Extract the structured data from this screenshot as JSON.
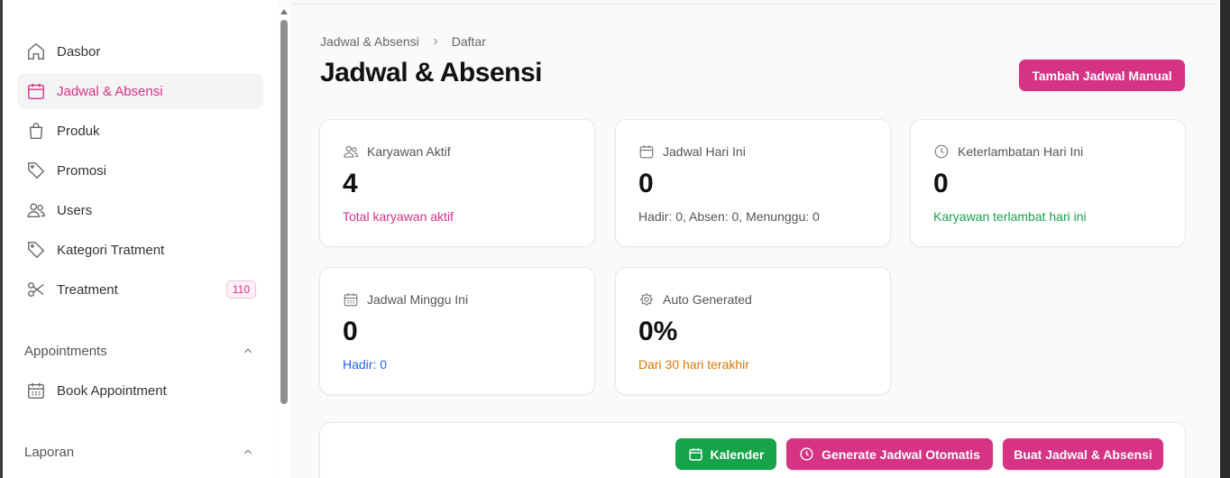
{
  "sidebar": {
    "items": [
      {
        "label": "Dasbor",
        "icon": "home-icon"
      },
      {
        "label": "Jadwal & Absensi",
        "icon": "calendar-icon",
        "active": true
      },
      {
        "label": "Produk",
        "icon": "shopping-bag-icon"
      },
      {
        "label": "Promosi",
        "icon": "tag-icon"
      },
      {
        "label": "Users",
        "icon": "users-icon"
      },
      {
        "label": "Kategori Tratment",
        "icon": "tag-icon"
      },
      {
        "label": "Treatment",
        "icon": "scissors-icon",
        "badge": "110"
      }
    ],
    "sections": [
      {
        "label": "Appointments",
        "items": [
          {
            "label": "Book Appointment",
            "icon": "calendar-days-icon"
          }
        ]
      },
      {
        "label": "Laporan"
      }
    ]
  },
  "breadcrumb": {
    "parent": "Jadwal & Absensi",
    "current": "Daftar"
  },
  "page": {
    "title": "Jadwal & Absensi",
    "add_button": "Tambah Jadwal Manual"
  },
  "stats": [
    {
      "label": "Karyawan Aktif",
      "value": "4",
      "sub": "Total karyawan aktif",
      "icon": "users-icon",
      "sub_color": "#d63384"
    },
    {
      "label": "Jadwal Hari Ini",
      "value": "0",
      "sub": "Hadir: 0, Absen: 0, Menunggu: 0",
      "icon": "calendar-icon",
      "sub_color": "#555555"
    },
    {
      "label": "Keterlambatan Hari Ini",
      "value": "0",
      "sub": "Karyawan terlambat hari ini",
      "icon": "clock-icon",
      "sub_color": "#16a34a"
    },
    {
      "label": "Jadwal Minggu Ini",
      "value": "0",
      "sub": "Hadir: 0",
      "icon": "calendar-days-icon",
      "sub_color": "#2563eb"
    },
    {
      "label": "Auto Generated",
      "value": "0%",
      "sub": "Dari 30 hari terakhir",
      "icon": "gear-icon",
      "sub_color": "#d97706"
    }
  ],
  "actions": {
    "calendar": "Kalender",
    "generate": "Generate Jadwal Otomatis",
    "create": "Buat Jadwal & Absensi"
  },
  "colors": {
    "accent": "#d63384",
    "green": "#16a34a",
    "blue": "#2563eb",
    "orange": "#d97706"
  }
}
